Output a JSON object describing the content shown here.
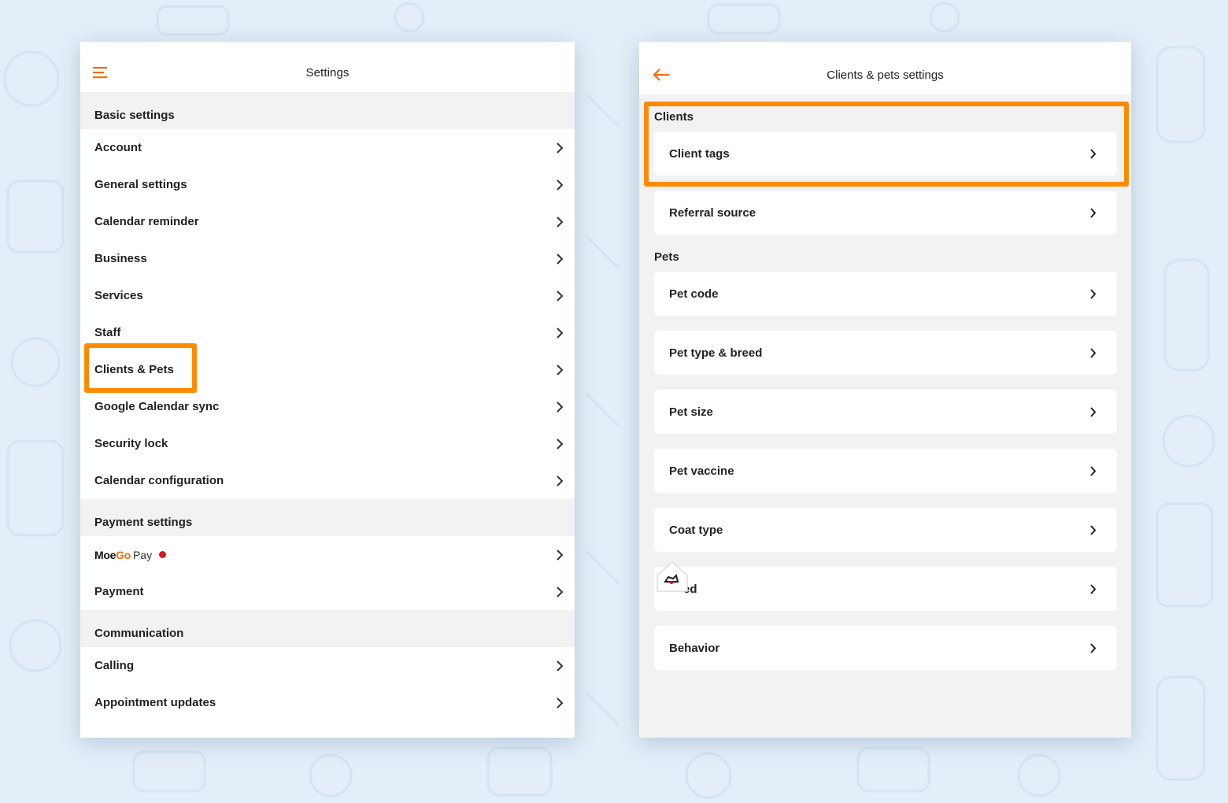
{
  "colors": {
    "accent": "#f96b0a",
    "highlight": "#ff8a00",
    "notification_dot": "#d7151c",
    "page_background": "#e3eef8"
  },
  "left": {
    "title": "Settings",
    "menu_icon": "hamburger-menu-icon",
    "sections": [
      {
        "heading": "Basic settings",
        "items": [
          "Account",
          "General settings",
          "Calendar reminder",
          "Business",
          "Services",
          "Staff",
          "Clients & Pets",
          "Google Calendar sync",
          "Security lock",
          "Calendar configuration"
        ]
      },
      {
        "heading": "Payment settings",
        "moego_pay": {
          "moe": "Moe",
          "go": "Go",
          "pay": "Pay"
        },
        "items": [
          "Payment"
        ]
      },
      {
        "heading": "Communication",
        "items": [
          "Calling",
          "Appointment updates"
        ]
      }
    ]
  },
  "right": {
    "title": "Clients & pets settings",
    "back_icon": "back-arrow-icon",
    "clients_label": "Clients",
    "client_items": [
      "Client tags",
      "Referral source"
    ],
    "pets_label": "Pets",
    "pet_items": [
      "Pet code",
      "Pet type & breed",
      "Pet size",
      "Pet vaccine",
      "Coat type",
      "ed",
      "Behavior"
    ]
  }
}
